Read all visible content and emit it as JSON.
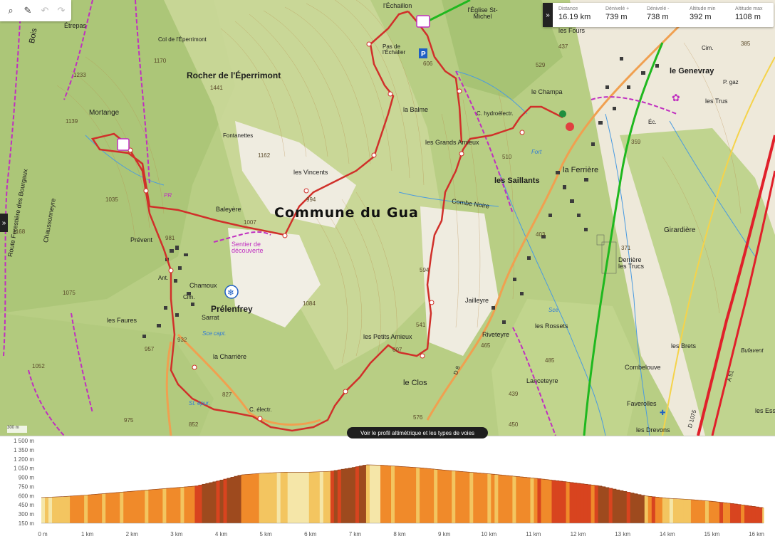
{
  "toolbar": {
    "tools": [
      "search-icon",
      "wrench-icon",
      "undo-icon",
      "redo-icon"
    ],
    "expand_label": "»"
  },
  "stats": {
    "toggle": "»",
    "items": [
      {
        "key": "Distance",
        "value": "16.19 km"
      },
      {
        "key": "Dénivelé +",
        "value": "739 m"
      },
      {
        "key": "Dénivelé -",
        "value": "738 m"
      },
      {
        "key": "Altitude min",
        "value": "392 m"
      },
      {
        "key": "Altitude max",
        "value": "1108 m"
      }
    ]
  },
  "map": {
    "labels": {
      "commune": "Commune du Gua",
      "rocher": "Rocher de l'Éperrimont",
      "col": "Col de l'Éperrimont",
      "col_alt": "1170",
      "etrepas": "Étrepas",
      "bois": "Bois",
      "mortange": "Mortange",
      "mortange_alt": "1139",
      "alt_1233": "1233",
      "alt_1441": "1441",
      "fontanettes": "Fontanettes",
      "alt_1162": "1162",
      "vincents": "les Vincents",
      "baleyere": "Baleyère",
      "alt_1007": "1007",
      "alt_994": "994",
      "prevent": "Prévent",
      "alt_981": "981",
      "alt_1035": "1035",
      "alt_1168": "1168",
      "sentier": "Sentier de découverte",
      "chamoux": "Chamoux",
      "prelenfrey": "Prélenfrey",
      "cim": "Cim.",
      "ant": "Ant.",
      "sarrat": "Sarrat",
      "faures": "les Faures",
      "alt_1075": "1075",
      "alt_957": "957",
      "alt_932": "932",
      "charriere": "la Charrière",
      "alt_1084": "1084",
      "alt_827": "827",
      "st_epur": "St. épur.",
      "c_electr": "C. électr.",
      "alt_852": "852",
      "alt_975": "975",
      "alt_1052": "1052",
      "sce_capt": "Sce capt.",
      "echaillon": "l'Échaillon",
      "pas_echalier": "Pas de l'Échalier",
      "alt_606": "606",
      "eglise": "l'Église St-Michel",
      "balme": "la Balme",
      "grands_amieux": "les Grands Amieux",
      "c_hydro": "C. hydroélectr.",
      "saillants": "les Saillants",
      "alt_510": "510",
      "fort": "Fort",
      "combe_noire": "Combe Noire",
      "alt_594": "594",
      "jailleyre": "Jailleyre",
      "petits_amieux": "les Petits Amieux",
      "alt_541": "541",
      "alt_607": "607",
      "riveteyre": "Riveteyre",
      "alt_465": "465",
      "le_clos": "le Clos",
      "d8": "D 8",
      "rossets": "les Rossets",
      "lanceteyre": "Lanceteyre",
      "alt_485": "485",
      "alt_439": "439",
      "alt_450": "450",
      "alt_576": "576",
      "les_fours": "les Fours",
      "alt_437": "437",
      "alt_529": "529",
      "le_champa": "le Champa",
      "la_ferriere": "la Ferrière",
      "le_genevray": "le Genevray",
      "alt_385": "385",
      "cim2": "Cim.",
      "les_trus": "les Trus",
      "p_gaz": "P. gaz",
      "alt_359": "359",
      "ec": "Éc.",
      "girardiere": "Girardière",
      "alt_403": "403",
      "alt_371": "371",
      "derriere": "Derrière les Trucs",
      "les_brets": "les Brets",
      "bufavent": "Bufavent",
      "combelouve": "Combelouve",
      "faverolles": "Faverolles",
      "drevons": "les Drevons",
      "les_ess": "les Ess",
      "d1075": "D 1075",
      "a51": "A 51",
      "sce": "Sce",
      "pr": "PR",
      "route_forestiere": "Route Forestière des Bourgaux",
      "chaussonneyre": "Chaussonneyre",
      "alt_1139b": "1139"
    },
    "scale_label": "300 m",
    "profile_button": "Voir le profil altimétrique et les types de voies",
    "colors": {
      "route": "#d0302a",
      "pr": "#c02fc0",
      "gr": "#1fb81f",
      "road": "#f0a050",
      "motorway": "#e0202a"
    }
  },
  "chart_data": {
    "type": "area",
    "title": "",
    "xlabel": "",
    "ylabel": "",
    "x_ticks": [
      "0 m",
      "1 km",
      "2 km",
      "3 km",
      "4 km",
      "5 km",
      "6 km",
      "7 km",
      "8 km",
      "9 km",
      "10 km",
      "11 km",
      "12 km",
      "13 km",
      "14 km",
      "15 km",
      "16 km"
    ],
    "y_ticks": [
      "150 m",
      "300 m",
      "450 m",
      "600 m",
      "750 m",
      "900 m",
      "1 050 m",
      "1 200 m",
      "1 350 m",
      "1 500 m"
    ],
    "ylim": [
      150,
      1500
    ],
    "xlim": [
      0,
      16.19
    ],
    "x": [
      0,
      0.5,
      1,
      1.5,
      2,
      2.5,
      3,
      3.5,
      4,
      4.5,
      5,
      5.5,
      6,
      6.5,
      7,
      7.3,
      7.6,
      8,
      8.5,
      9,
      9.5,
      10,
      10.5,
      11,
      11.5,
      12,
      12.5,
      13,
      13.5,
      14,
      14.5,
      15,
      15.5,
      16,
      16.19
    ],
    "y": [
      570,
      585,
      610,
      640,
      670,
      700,
      730,
      760,
      845,
      940,
      970,
      985,
      985,
      1000,
      1060,
      1105,
      1100,
      1080,
      1055,
      1020,
      990,
      960,
      925,
      890,
      850,
      805,
      760,
      680,
      600,
      560,
      540,
      510,
      470,
      420,
      400
    ],
    "series": [
      {
        "values": "elevation"
      }
    ]
  }
}
